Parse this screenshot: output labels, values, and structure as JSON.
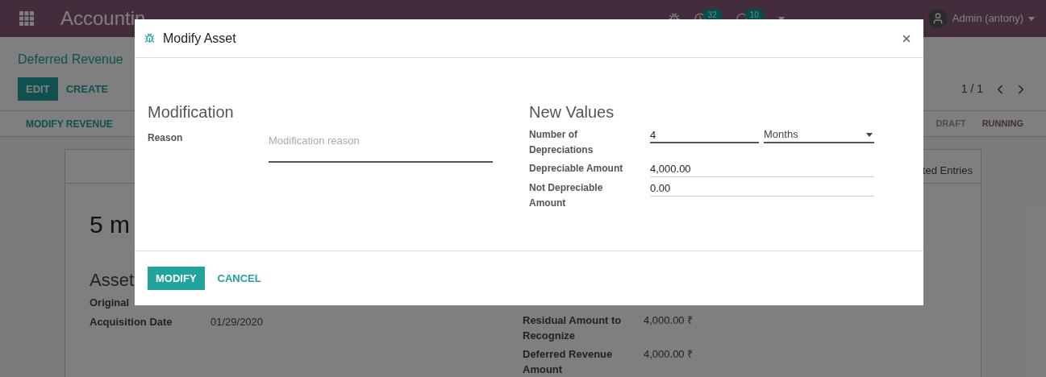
{
  "navbar": {
    "app_title": "Accountin",
    "activity_count": "32",
    "message_count": "10",
    "user": "Admin (antony)"
  },
  "control_panel": {
    "breadcrumb": "Deferred Revenue",
    "buttons": [
      {
        "label": "EDIT",
        "kind": "primary"
      },
      {
        "label": "CREATE",
        "kind": "link"
      }
    ],
    "pager": "1 / 1"
  },
  "statusbar": {
    "action": "MODIFY REVENUE",
    "stages": [
      {
        "label": "DRAFT",
        "selected": false
      },
      {
        "label": "RUNNING",
        "selected": true
      }
    ]
  },
  "sheet": {
    "tab": "ted Entries",
    "title": "5 m",
    "section": "Asset",
    "fields_left": [
      {
        "label": "Original"
      },
      {
        "label": "Acquisition Date",
        "value": "01/29/2020"
      }
    ],
    "fields_right": [
      {
        "label": "Residual Amount to Recognize",
        "value": "4,000.00 ₹"
      },
      {
        "label": "Deferred Revenue Amount",
        "value": "4,000.00 ₹"
      }
    ]
  },
  "dialog": {
    "title": "Modify Asset",
    "left": {
      "heading": "Modification",
      "fields": [
        {
          "kind": "textarea",
          "label": "Reason",
          "placeholder": "Modification reason"
        }
      ]
    },
    "right": {
      "heading": "New Values",
      "fields": [
        {
          "kind": "number_with_unit",
          "label": "Number of Depreciations",
          "value": "4",
          "unit": "Months"
        },
        {
          "kind": "text",
          "label": "Depreciable Amount",
          "value": "4,000.00"
        },
        {
          "kind": "text",
          "label": "Not Depreciable Amount",
          "value": "0.00"
        }
      ]
    },
    "buttons": [
      {
        "label": "MODIFY",
        "kind": "primary"
      },
      {
        "label": "CANCEL",
        "kind": "link"
      }
    ]
  }
}
